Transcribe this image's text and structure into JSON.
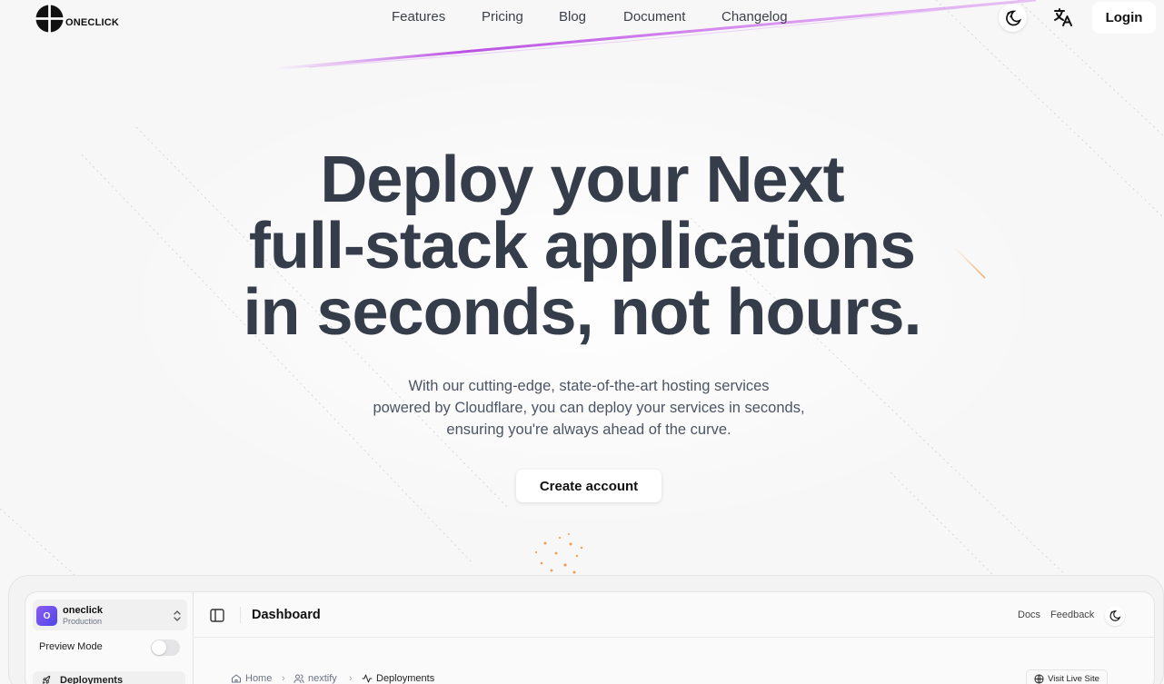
{
  "brand": {
    "name": "ONECLICK"
  },
  "nav": {
    "items": [
      "Features",
      "Pricing",
      "Blog",
      "Document",
      "Changelog"
    ]
  },
  "header": {
    "theme_icon": "moon-sun-icon",
    "language_icon": "translate-icon",
    "login_label": "Login"
  },
  "hero": {
    "title_lines": [
      "Deploy your Next",
      "full-stack applications",
      "in seconds, not hours."
    ],
    "subtitle_lines": [
      "With our cutting-edge, state-of-the-art hosting services",
      "powered by Cloudflare, you can deploy your services in seconds,",
      "ensuring you're always ahead of the curve."
    ],
    "cta_label": "Create account"
  },
  "dashboard_preview": {
    "org": {
      "avatar_letter": "O",
      "name": "oneclick",
      "env": "Production"
    },
    "preview_mode_label": "Preview Mode",
    "preview_mode_on": false,
    "sidebar_items": [
      "Deployments"
    ],
    "title": "Dashboard",
    "docs_label": "Docs",
    "feedback_label": "Feedback",
    "breadcrumb": [
      "Home",
      "nextify",
      "Deployments"
    ],
    "visit_label": "Visit Live Site"
  },
  "colors": {
    "heading": "#353d4b",
    "accent_streak": "#c14ee8",
    "spark": "#f0a050",
    "avatar": "#6d5bf0"
  }
}
